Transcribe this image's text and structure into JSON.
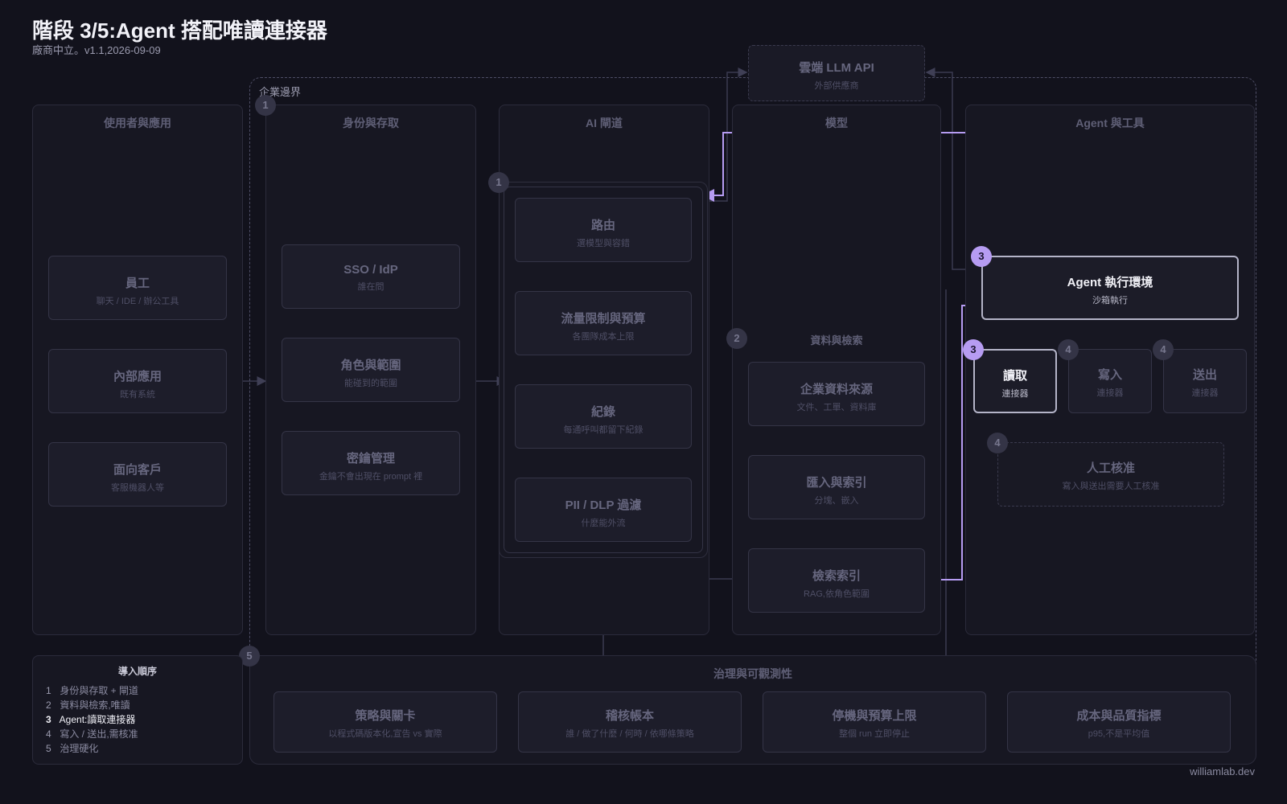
{
  "header": {
    "title": "階段 3/5:Agent 搭配唯讀連接器",
    "subtitle": "廠商中立。v1.1,2026-09-09"
  },
  "footer": {
    "credit": "williamlab.dev"
  },
  "boundary": {
    "label": "企業邊界"
  },
  "cloud": {
    "title": "雲端 LLM API",
    "sub": "外部供應商"
  },
  "lanes": {
    "users": {
      "title": "使用者與應用",
      "items": [
        {
          "title": "員工",
          "sub": "聊天 / IDE / 辦公工具"
        },
        {
          "title": "內部應用",
          "sub": "既有系統"
        },
        {
          "title": "面向客戶",
          "sub": "客服機器人等"
        }
      ]
    },
    "identity": {
      "title": "身份與存取",
      "badge": "1",
      "items": [
        {
          "title": "SSO / IdP",
          "sub": "誰在問"
        },
        {
          "title": "角色與範圍",
          "sub": "能碰到的範圍"
        },
        {
          "title": "密鑰管理",
          "sub": "金鑰不會出現在 prompt 裡"
        }
      ]
    },
    "gateway": {
      "title": "AI 閘道",
      "badge": "1",
      "items": [
        {
          "title": "路由",
          "sub": "選模型與容錯"
        },
        {
          "title": "流量限制與預算",
          "sub": "各團隊成本上限"
        },
        {
          "title": "紀錄",
          "sub": "每通呼叫都留下紀錄"
        },
        {
          "title": "PII / DLP 過濾",
          "sub": "什麼能外流"
        }
      ]
    },
    "models": {
      "title": "模型",
      "section_badge": "2",
      "section_title": "資料與檢索",
      "items": [
        {
          "title": "企業資料來源",
          "sub": "文件、工單、資料庫"
        },
        {
          "title": "匯入與索引",
          "sub": "分塊、嵌入"
        },
        {
          "title": "檢索索引",
          "sub": "RAG,依角色範圍"
        }
      ]
    },
    "agent": {
      "title": "Agent 與工具",
      "runtime": {
        "title": "Agent 執行環境",
        "sub": "沙箱執行",
        "badge": "3"
      },
      "connectors": [
        {
          "title": "讀取",
          "sub": "連接器",
          "badge": "3",
          "active": true
        },
        {
          "title": "寫入",
          "sub": "連接器",
          "badge": "4",
          "active": false
        },
        {
          "title": "送出",
          "sub": "連接器",
          "badge": "4",
          "active": false
        }
      ],
      "approval": {
        "title": "人工核准",
        "sub": "寫入與送出需要人工核准",
        "badge": "4"
      }
    }
  },
  "governance": {
    "title": "治理與可觀測性",
    "badge": "5",
    "items": [
      {
        "title": "策略與關卡",
        "sub": "以程式碼版本化,宣告 vs 實際"
      },
      {
        "title": "稽核帳本",
        "sub": "誰 / 做了什麼 / 何時 / 依哪條策略"
      },
      {
        "title": "停機與預算上限",
        "sub": "整個 run 立即停止"
      },
      {
        "title": "成本與品質指標",
        "sub": "p95,不是平均值"
      }
    ]
  },
  "legend": {
    "title": "導入順序",
    "items": [
      {
        "num": "1",
        "label": "身份與存取 + 閘道"
      },
      {
        "num": "2",
        "label": "資料與檢索,唯讀"
      },
      {
        "num": "3",
        "label": "Agent:讀取連接器"
      },
      {
        "num": "4",
        "label": "寫入 / 送出,需核准"
      },
      {
        "num": "5",
        "label": "治理硬化"
      }
    ],
    "active_index": 2
  },
  "colors": {
    "accent": "#b69cf2",
    "background": "#12121c",
    "lane": "#171722",
    "box": "#1d1d2a"
  }
}
